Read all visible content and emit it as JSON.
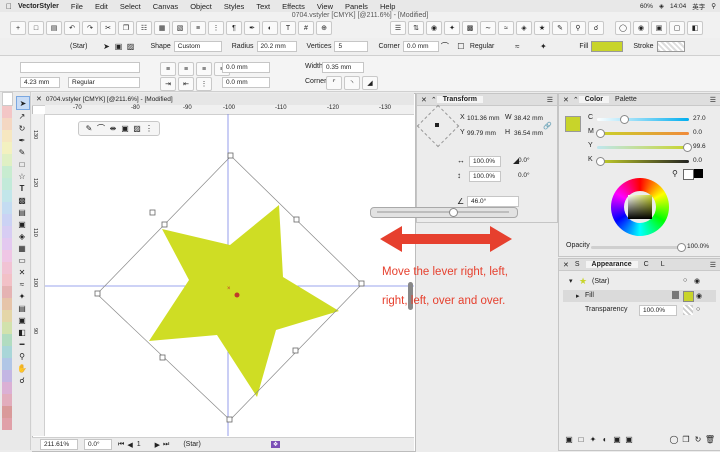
{
  "menubar": {
    "app": "VectorStyler",
    "items": [
      "File",
      "Edit",
      "Select",
      "Canvas",
      "Object",
      "Styles",
      "Text",
      "Effects",
      "View",
      "Panels",
      "Help"
    ],
    "status_battery": "60%",
    "status_time": "14:04",
    "status_lang": "英字"
  },
  "toolbar1": {
    "doc_title": "0704.vstyler [CMYK] [@211.6%] - [Modified]"
  },
  "toolbar2": {
    "object_label": "(Star)",
    "shape_label": "Shape",
    "shape_value": "Custom",
    "radius_label": "Radius",
    "radius_value": "20.2 mm",
    "vertices_label": "Vertices",
    "vertices_value": "5",
    "corner_label": "Corner",
    "corner_value": "0.0 mm",
    "regular_label": "Regular",
    "fill_label": "Fill",
    "stroke_label": "Stroke",
    "fill_color": "#c8d42a"
  },
  "toolbar3": {
    "size_value": "4.23 mm",
    "style_value": "Regular",
    "spacing1_value": "0.0 mm",
    "spacing2_value": "0.0 mm",
    "width_label": "Width",
    "width_value": "0.35 mm",
    "corner_label": "Corner"
  },
  "canvas": {
    "tab_title": "0704.vstyler [CMYK] [@211.6%] - [Modified]",
    "ruler_top": [
      "-70",
      "-80",
      "-90",
      "-100",
      "-110",
      "-120",
      "-130"
    ],
    "ruler_left": [
      "130",
      "120",
      "110",
      "100",
      "90"
    ],
    "star_color": "#cfdd24",
    "status_zoom": "211.61%",
    "status_angle": "0.0°",
    "status_page": "1",
    "status_object": "(Star)",
    "annotation_text": "Move the lever right, left, right, left, over and over.",
    "annotation_color": "#e6402e"
  },
  "transform": {
    "tab": "Transform",
    "x_label": "X",
    "x_value": "101.36 mm",
    "y_label": "Y",
    "y_value": "99.79 mm",
    "w_label": "W",
    "w_value": "38.42 mm",
    "h_label": "H",
    "h_value": "36.54 mm",
    "scale_w": "100.0%",
    "scale_h": "100.0%",
    "skew_1": "0.0°",
    "skew_2": "0.0°",
    "rotate": "46.0°"
  },
  "color": {
    "tabs": [
      "Color",
      "Palette"
    ],
    "c_label": "C",
    "c_value": "27.0",
    "m_label": "M",
    "m_value": "0.0",
    "y_label": "Y",
    "y_value": "99.6",
    "k_label": "K",
    "k_value": "0.0",
    "opacity_label": "Opacity",
    "opacity_value": "100.0%"
  },
  "appearance": {
    "tabs": [
      "S",
      "Appearance",
      "C",
      "L"
    ],
    "object": "(Star)",
    "fill": "Fill",
    "transparency_label": "Transparency",
    "transparency_value": "100.0%"
  }
}
